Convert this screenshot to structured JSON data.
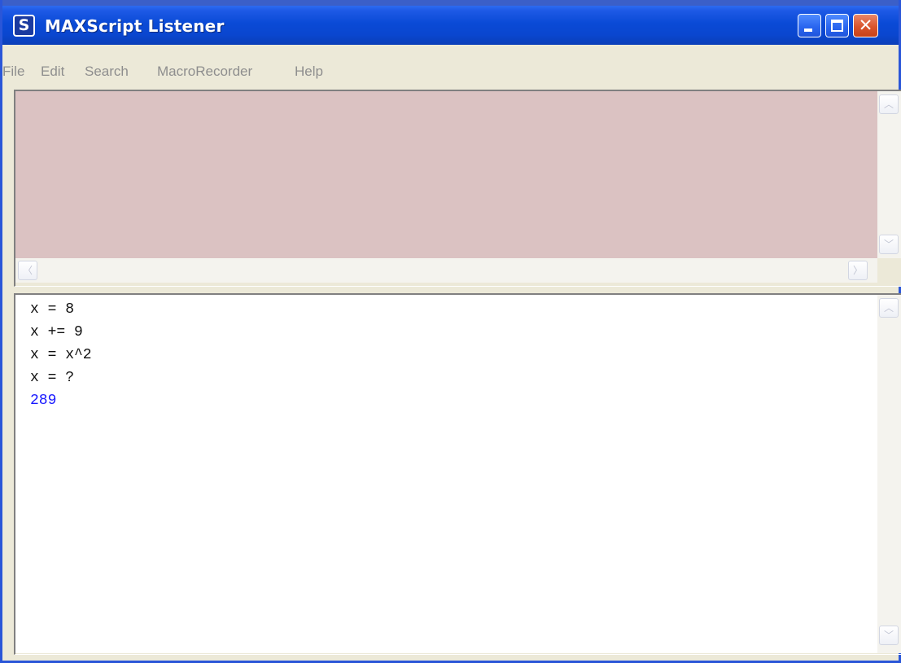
{
  "window": {
    "title": "MAXScript Listener",
    "app_icon_glyph": "S",
    "controls": {
      "minimize_icon": "minimize-icon",
      "maximize_icon": "maximize-icon",
      "close_icon": "close-icon"
    },
    "colors": {
      "titlebar": "#0a4ad6",
      "close_button": "#d9542c"
    }
  },
  "menu": {
    "items": [
      "File",
      "Edit",
      "Search",
      "MacroRecorder",
      "Help"
    ]
  },
  "macro_recorder_pane": {
    "background_color": "#dbc2c2",
    "content": ""
  },
  "scrollbars": {
    "up_glyph": "︿",
    "down_glyph": "﹀",
    "left_glyph": "〈",
    "right_glyph": "〉"
  },
  "listener_pane": {
    "lines": [
      {
        "text": "x = 8",
        "type": "input"
      },
      {
        "text": "x += 9",
        "type": "input"
      },
      {
        "text": "x = x^2",
        "type": "input"
      },
      {
        "text": "x = ?",
        "type": "input"
      },
      {
        "text": "289",
        "type": "result"
      }
    ],
    "result_color": "#1818ff"
  }
}
